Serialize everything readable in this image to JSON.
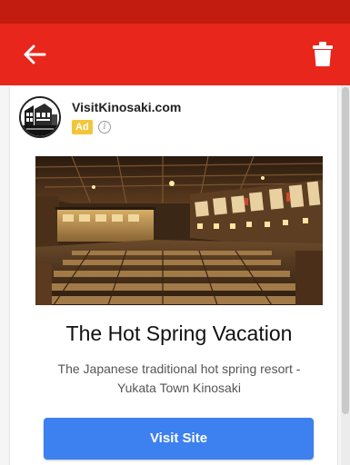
{
  "colors": {
    "status_strip": "#c21b10",
    "app_bar": "#e8261c",
    "ad_badge": "#f3c63a",
    "cta": "#3d80f0"
  },
  "toolbar": {
    "back_icon": "arrow-left-icon",
    "delete_icon": "trash-icon"
  },
  "ad": {
    "advertiser": "VisitKinosaki.com",
    "badge": "Ad",
    "info_icon": "info-icon",
    "headline": "The Hot Spring Vacation",
    "description": "The Japanese traditional hot spring resort - Yukata Town Kinosaki",
    "cta_label": "Visit Site"
  }
}
